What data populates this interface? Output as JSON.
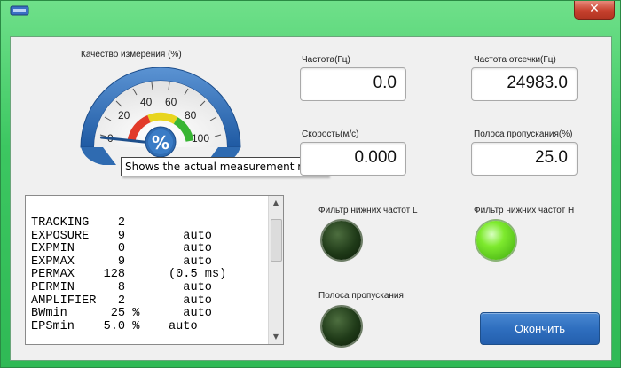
{
  "window": {
    "title": "",
    "close_label": "✕",
    "icon": "app-icon"
  },
  "gauge": {
    "label": "Качество измерения (%)",
    "ticks": [
      "0",
      "20",
      "40",
      "60",
      "80",
      "100"
    ],
    "center_symbol": "%",
    "value_percent": 0,
    "tooltip": "Shows the actual measurement rate",
    "colors": {
      "red": "#e23b2a",
      "yellow": "#e8d51e",
      "green": "#38b534",
      "rim": "#2f6bb1"
    }
  },
  "fields": {
    "frequency": {
      "label": "Частота(Гц)",
      "value": "0.0"
    },
    "cutoff_frequency": {
      "label": "Частота отсечки(Гц)",
      "value": "24983.0"
    },
    "speed": {
      "label": "Скорость(м/с)",
      "value": "0.000"
    },
    "bandwidth_percent": {
      "label": "Полоса пропускания(%)",
      "value": "25.0"
    }
  },
  "console": {
    "lines": [
      "TRACKING    2",
      "EXPOSURE    9        auto",
      "EXPMIN      0        auto",
      "EXPMAX      9        auto",
      "PERMAX    128      (0.5 ms)",
      "PERMIN      8        auto",
      "AMPLIFIER   2        auto",
      "BWmin      25 %      auto",
      "EPSmin    5.0 %    auto"
    ]
  },
  "indicators": {
    "low_filter_l": {
      "label": "Фильтр нижних частот L",
      "state": "off"
    },
    "low_filter_h": {
      "label": "Фильтр нижних частот H",
      "state": "on"
    },
    "bandwidth": {
      "label": "Полоса пропускания",
      "state": "off"
    }
  },
  "finish_button": {
    "label": "Окончить"
  }
}
